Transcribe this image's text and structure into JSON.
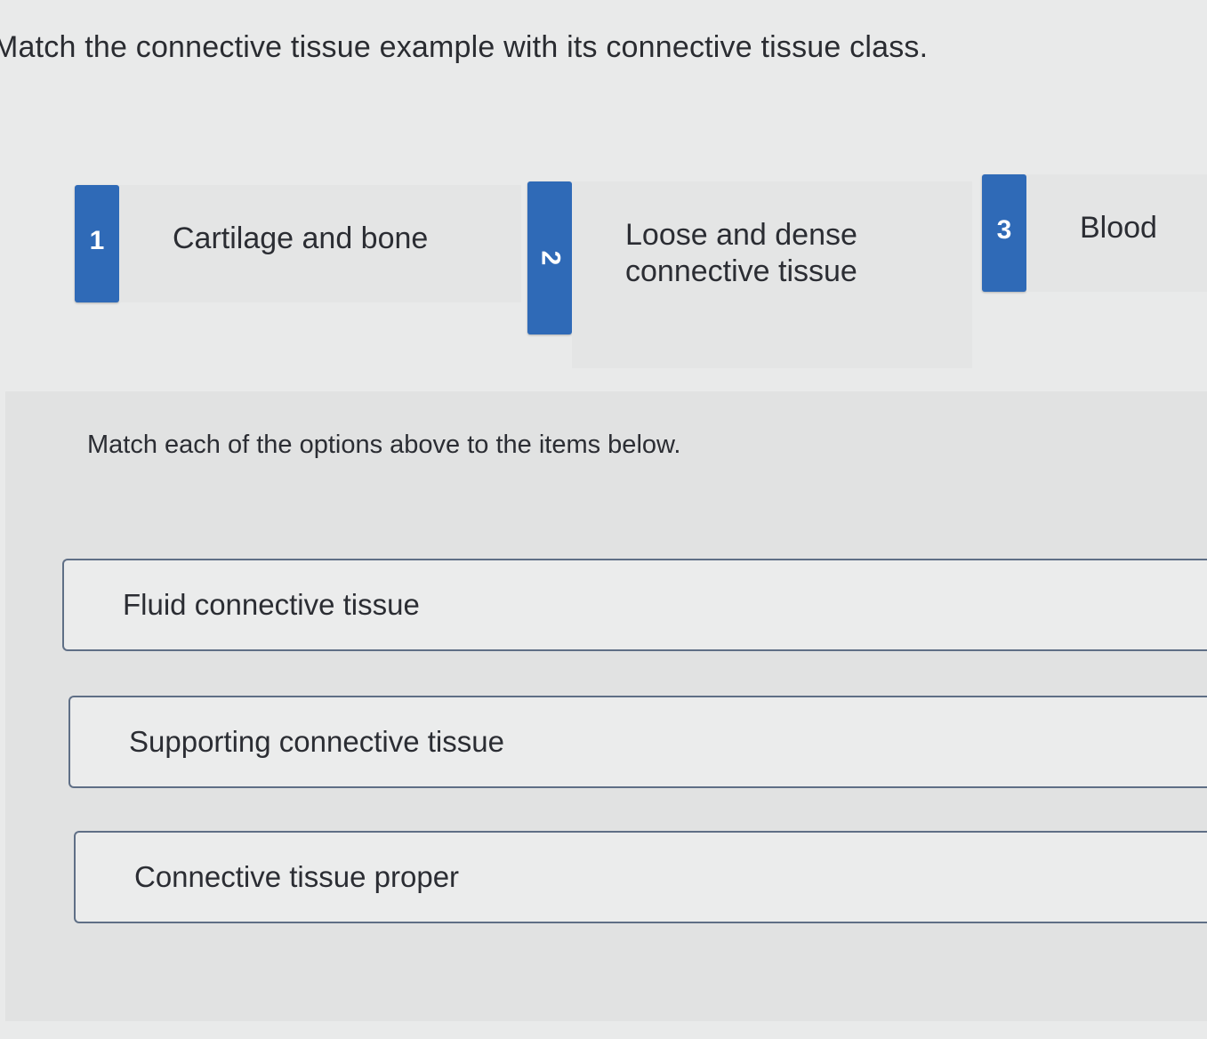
{
  "question": {
    "title": "Match the connective tissue example with its connective tissue class."
  },
  "options": [
    {
      "number": "1",
      "label": "Cartilage and bone"
    },
    {
      "number": "2",
      "label_line1": "Loose and dense",
      "label_line2": "connective tissue"
    },
    {
      "number": "3",
      "label": "Blood"
    }
  ],
  "match": {
    "instruction": "Match each of the options above to the items below.",
    "targets": [
      {
        "label": "Fluid connective tissue"
      },
      {
        "label": "Supporting connective tissue"
      },
      {
        "label": "Connective tissue proper"
      }
    ]
  },
  "colors": {
    "badge": "#2f6ab7",
    "background": "#e9eaea",
    "target_border": "#5f6f86"
  }
}
